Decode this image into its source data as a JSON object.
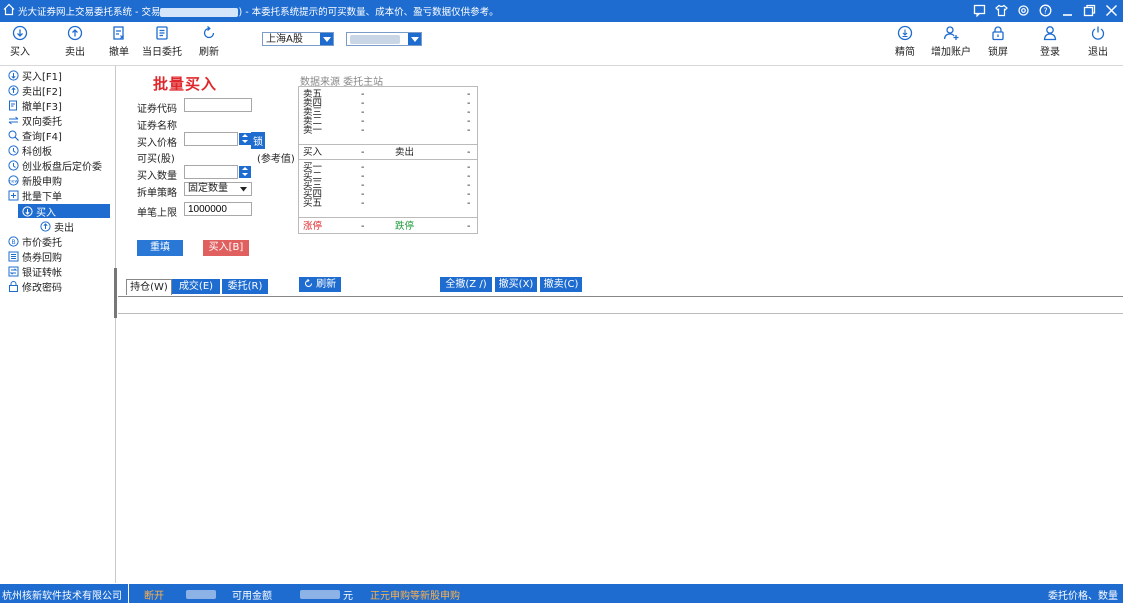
{
  "window": {
    "title_prefix": "光大证券网上交易委托系统 - 交易",
    "title_suffix": ") - 本委托系统提示的可买数量、成本价、盈亏数据仅供参考。"
  },
  "toolbar": {
    "buy": "买入",
    "sell": "卖出",
    "cancel": "撤单",
    "today_orders": "当日委托",
    "refresh": "刷新",
    "market_select": "上海A股",
    "account_select": "",
    "simple": "精简",
    "add_account": "增加账户",
    "lock": "锁屏",
    "login": "登录",
    "exit": "退出"
  },
  "sidebar": {
    "items": [
      {
        "label": "买入[F1]",
        "icon": "buy-circle-icon"
      },
      {
        "label": "卖出[F2]",
        "icon": "sell-circle-icon"
      },
      {
        "label": "撤单[F3]",
        "icon": "cancel-doc-icon"
      },
      {
        "label": "双向委托",
        "icon": "two-way-icon"
      },
      {
        "label": "查询[F4]",
        "icon": "search-icon"
      },
      {
        "label": "科创板",
        "icon": "star-board-icon"
      },
      {
        "label": "创业板盘后定价委",
        "icon": "gem-board-icon"
      },
      {
        "label": "新股申购",
        "icon": "new-stock-icon"
      },
      {
        "label": "批量下单",
        "icon": "batch-icon"
      },
      {
        "label": "买入",
        "icon": "buy-circle-icon"
      },
      {
        "label": "卖出",
        "icon": "sell-circle-icon"
      },
      {
        "label": "市价委托",
        "icon": "market-price-icon"
      },
      {
        "label": "债券回购",
        "icon": "bond-icon"
      },
      {
        "label": "银证转帐",
        "icon": "transfer-icon"
      },
      {
        "label": "修改密码",
        "icon": "lock-icon"
      }
    ]
  },
  "form": {
    "title": "批量买入",
    "code_label": "证券代码",
    "code_value": "",
    "name_label": "证券名称",
    "name_value": "",
    "price_label": "买入价格",
    "price_value": "",
    "lock_label": "锁",
    "avail_label": "可买(股)",
    "ref_label": "(参考值)",
    "qty_label": "买入数量",
    "qty_value": "",
    "split_label": "拆单策略",
    "split_value": "固定数量",
    "limit_label": "单笔上限",
    "limit_value": "1000000",
    "reset_btn": "重填",
    "buy_btn": "买入[B]"
  },
  "book": {
    "header": "数据来源 委托主站",
    "asks": [
      "卖五",
      "卖四",
      "卖三",
      "卖二",
      "卖一"
    ],
    "bids": [
      "买一",
      "买二",
      "买三",
      "买四",
      "买五"
    ],
    "dash": "-",
    "mid_buy": "买入",
    "mid_sell": "卖出",
    "limit_up": "涨停",
    "limit_down": "跌停"
  },
  "tabs": {
    "holdings": "持仓(W)",
    "trades": "成交(E)",
    "orders": "委托(R)",
    "refresh": "刷新",
    "cancel_all": "全撤(Z /)",
    "cancel_buy": "撤买(X)",
    "cancel_sell": "撤卖(C)"
  },
  "status": {
    "company": "杭州核新软件技术有限公司",
    "disconnect": "断开",
    "available": "可用金额",
    "yuan": "元",
    "ipo_notice": "正元申购等新股申购",
    "right": "委托价格、数量"
  },
  "colors": {
    "accent": "#1e6cd0",
    "red": "#e0282c",
    "reset_btn": "#2a78d6",
    "buy_btn": "#e06060"
  }
}
